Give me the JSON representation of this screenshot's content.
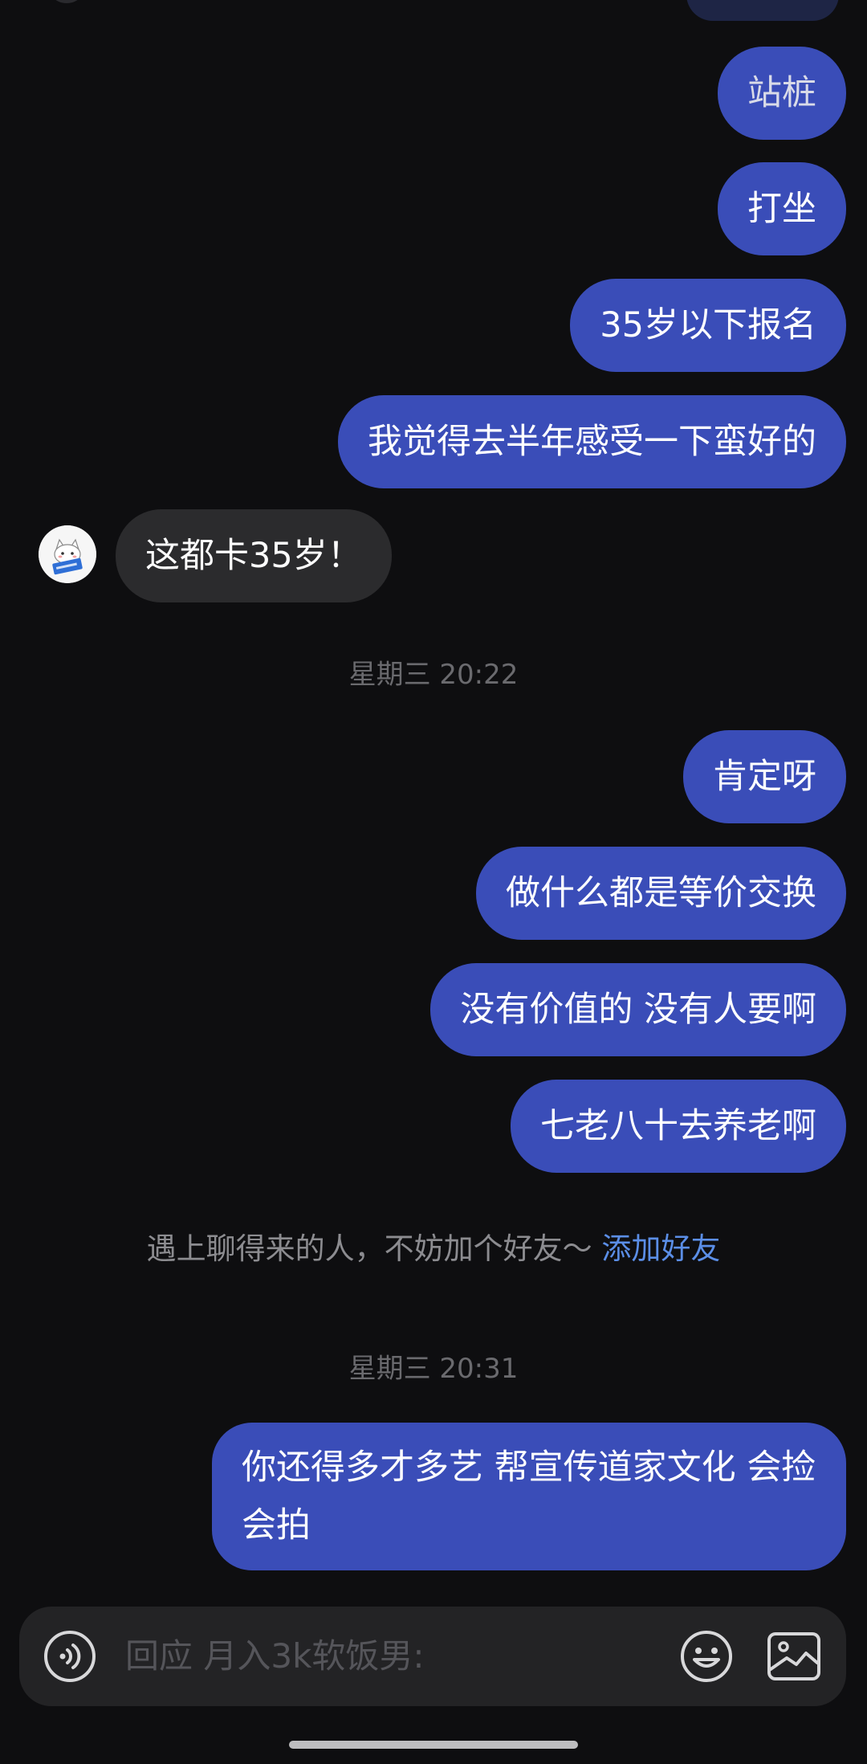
{
  "messages": [
    {
      "id": "m1",
      "side": "out",
      "text": "站桩"
    },
    {
      "id": "m2",
      "side": "out",
      "text": "打坐"
    },
    {
      "id": "m3",
      "side": "out",
      "text": "35岁以下报名"
    },
    {
      "id": "m4",
      "side": "out",
      "text": "我觉得去半年感受一下蛮好的"
    },
    {
      "id": "m5",
      "side": "in",
      "text": "这都卡35岁！"
    },
    {
      "id": "m6",
      "side": "out",
      "text": "肯定呀"
    },
    {
      "id": "m7",
      "side": "out",
      "text": "做什么都是等价交换"
    },
    {
      "id": "m8",
      "side": "out",
      "text": "没有价值的 没有人要啊"
    },
    {
      "id": "m9",
      "side": "out",
      "text": "七老八十去养老啊"
    },
    {
      "id": "m10",
      "side": "out",
      "text": "你还得多才多艺  帮宣传道家文化  会捡会拍"
    }
  ],
  "timestamps": {
    "t1": "星期三 20:22",
    "t2": "星期三 20:31"
  },
  "tip": {
    "text": "遇上聊得来的人，不妨加个好友～ ",
    "link": "添加好友"
  },
  "input": {
    "placeholder": "回应 月入3k软饭男:"
  },
  "icons": {
    "voice": "voice-wave-icon",
    "emoji": "emoji-icon",
    "image": "image-icon"
  },
  "colors": {
    "background": "#0e0e10",
    "outgoing_bubble": "#3a4db8",
    "incoming_bubble": "#2b2b2d",
    "link": "#5b8ee6",
    "timestamp": "#6a6a6e"
  }
}
